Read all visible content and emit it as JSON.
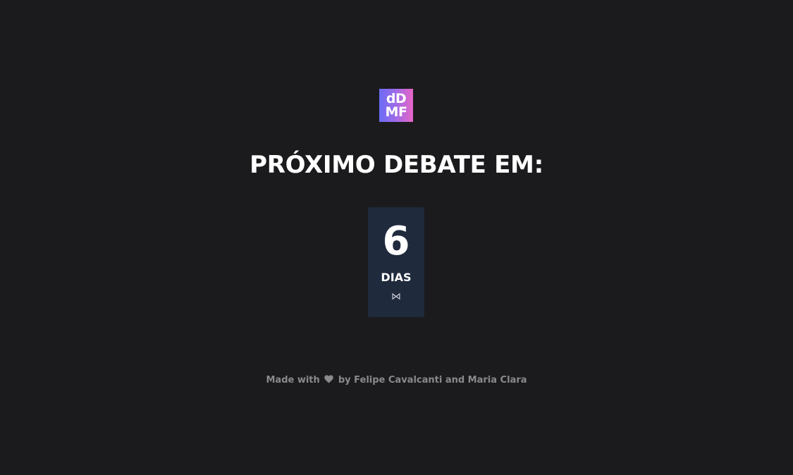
{
  "logo": {
    "line1": "dD",
    "line2": "MF"
  },
  "heading": "PRÓXIMO DEBATE EM:",
  "countdown": {
    "value": "6",
    "unit": "DIAS",
    "glyph": "⋈"
  },
  "footer": {
    "before": "Made with",
    "icon": "heart-icon",
    "after": "by Felipe Cavalcanti and Maria Clara"
  },
  "colors": {
    "background": "#1b1b1d",
    "card": "#1f2a3d",
    "footer_text": "#8a8a8d",
    "logo_gradient_start": "#6b6cf6",
    "logo_gradient_end": "#e766c6"
  }
}
